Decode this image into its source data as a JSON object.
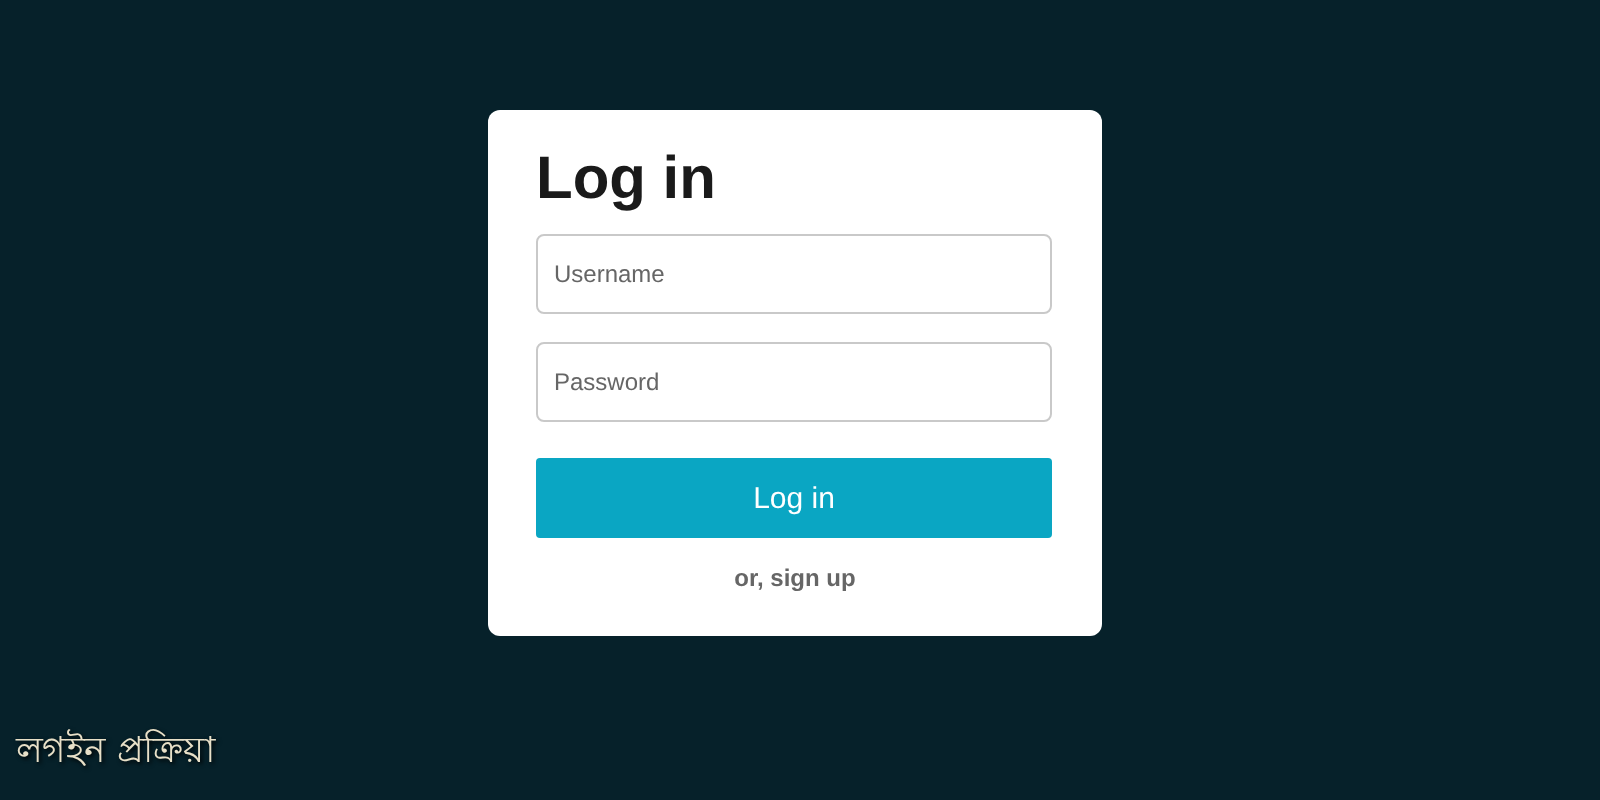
{
  "login_card": {
    "title": "Log in",
    "fields": [
      {
        "placeholder": "Username"
      },
      {
        "placeholder": "Password"
      }
    ],
    "submit_button": "Log in",
    "signup_link": "or, sign up"
  },
  "caption": "লগইন প্রক্রিয়া"
}
